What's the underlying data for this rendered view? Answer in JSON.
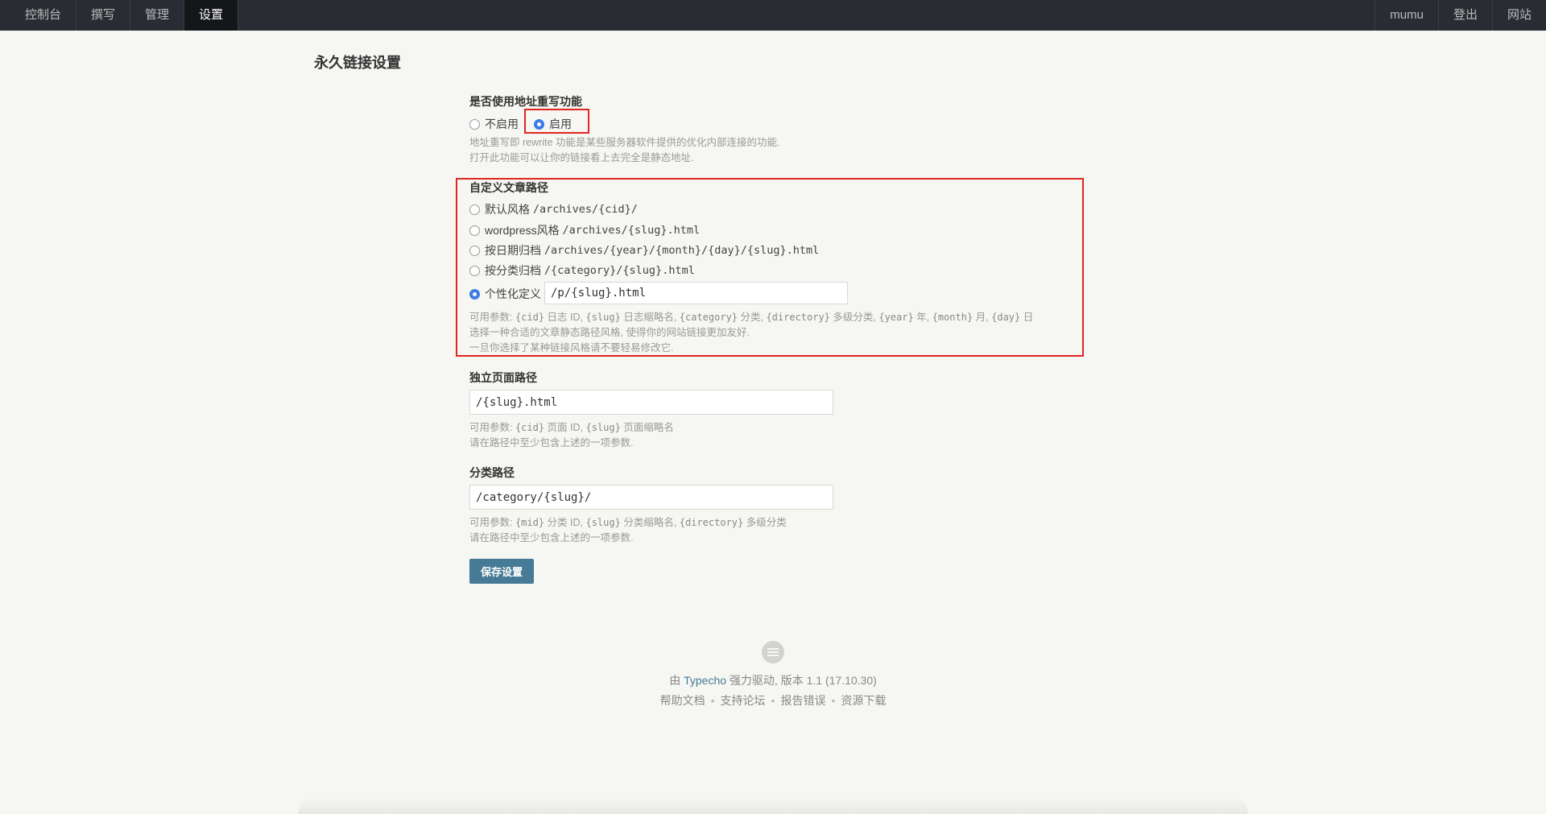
{
  "nav": {
    "left": [
      "控制台",
      "撰写",
      "管理",
      "设置"
    ],
    "active": "设置",
    "right": [
      "mumu",
      "登出",
      "网站"
    ]
  },
  "page_title": "永久链接设置",
  "rewrite": {
    "label": "是否使用地址重写功能",
    "options": [
      {
        "label": "不启用",
        "checked": false
      },
      {
        "label": "启用",
        "checked": true
      }
    ],
    "desc_line1": "地址重写即 rewrite 功能是某些服务器软件提供的优化内部连接的功能.",
    "desc_line2": "打开此功能可以让你的链接看上去完全是静态地址."
  },
  "post_path": {
    "label": "自定义文章路径",
    "options": [
      {
        "name": "默认风格",
        "pattern": "/archives/{cid}/",
        "checked": false
      },
      {
        "name": "wordpress风格",
        "pattern": "/archives/{slug}.html",
        "checked": false
      },
      {
        "name": "按日期归档",
        "pattern": "/archives/{year}/{month}/{day}/{slug}.html",
        "checked": false
      },
      {
        "name": "按分类归档",
        "pattern": "/{category}/{slug}.html",
        "checked": false
      }
    ],
    "custom_label": "个性化定义",
    "custom_checked": true,
    "custom_value": "/p/{slug}.html",
    "desc_prefix": "可用参数: ",
    "params": [
      {
        "code": "{cid}",
        "text": " 日志 ID, "
      },
      {
        "code": "{slug}",
        "text": " 日志缩略名, "
      },
      {
        "code": "{category}",
        "text": " 分类, "
      },
      {
        "code": "{directory}",
        "text": " 多级分类, "
      },
      {
        "code": "{year}",
        "text": " 年, "
      },
      {
        "code": "{month}",
        "text": " 月, "
      },
      {
        "code": "{day}",
        "text": " 日"
      }
    ],
    "desc_line2": "选择一种合适的文章静态路径风格, 使得你的网站链接更加友好.",
    "desc_line3": "一旦你选择了某种链接风格请不要轻易修改它."
  },
  "page_path": {
    "label": "独立页面路径",
    "value": "/{slug}.html",
    "desc_prefix": "可用参数: ",
    "params": [
      {
        "code": "{cid}",
        "text": " 页面 ID, "
      },
      {
        "code": "{slug}",
        "text": " 页面缩略名"
      }
    ],
    "desc_line2": "请在路径中至少包含上述的一项参数."
  },
  "category_path": {
    "label": "分类路径",
    "value": "/category/{slug}/",
    "desc_prefix": "可用参数: ",
    "params": [
      {
        "code": "{mid}",
        "text": " 分类 ID, "
      },
      {
        "code": "{slug}",
        "text": " 分类缩略名, "
      },
      {
        "code": "{directory}",
        "text": " 多级分类"
      }
    ],
    "desc_line2": "请在路径中至少包含上述的一项参数."
  },
  "save_label": "保存设置",
  "footer": {
    "powered_prefix": "由 ",
    "powered_link": "Typecho",
    "powered_suffix": " 强力驱动, 版本 1.1 (17.10.30)",
    "links": [
      "帮助文档",
      "支持论坛",
      "报告错误",
      "资源下载"
    ]
  },
  "colors": {
    "topbar": "#292d33",
    "accent": "#467b96",
    "radio_checked": "#3c7ce6",
    "highlight_box": "#e0261f"
  }
}
